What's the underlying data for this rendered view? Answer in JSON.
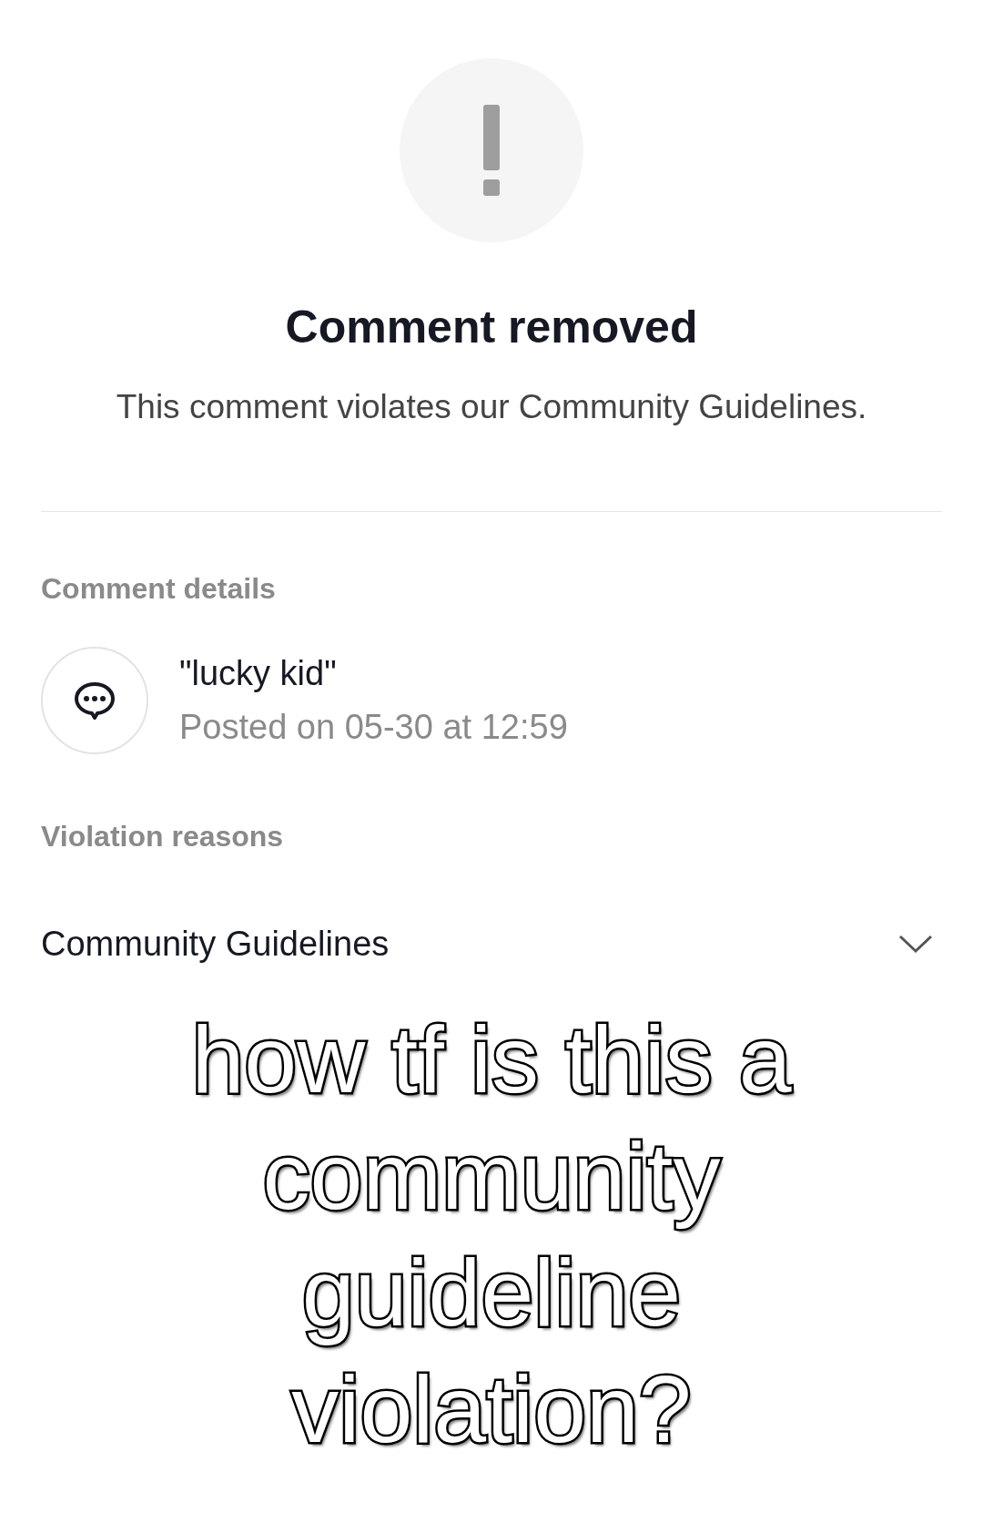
{
  "header": {
    "title": "Comment removed",
    "subtitle": "This comment violates our Community Guidelines."
  },
  "comment_details": {
    "heading": "Comment details",
    "text": "\"lucky kid\"",
    "posted": "Posted on 05-30 at 12:59"
  },
  "violation_reasons": {
    "heading": "Violation reasons",
    "items": [
      {
        "label": "Community Guidelines",
        "expanded": false
      }
    ]
  },
  "caption": [
    "how tf is this a",
    "community",
    "guideline",
    "violation?"
  ]
}
